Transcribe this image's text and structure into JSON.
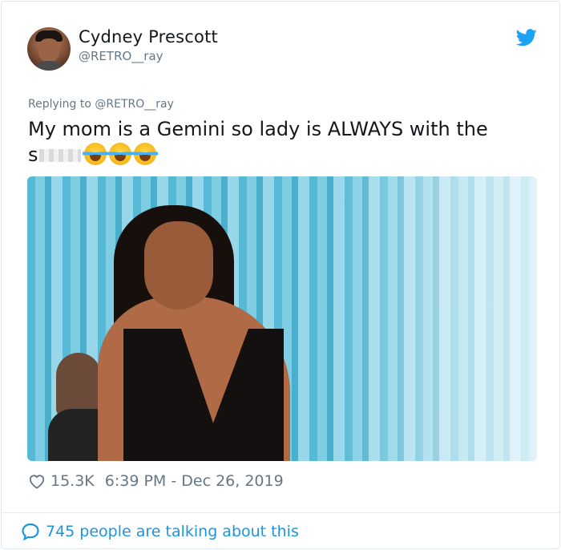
{
  "tweet": {
    "author_name": "Cydney Prescott",
    "author_handle": "@RETRO__ray",
    "replying_to": "Replying to @RETRO__ray",
    "text_line1": "My mom is a Gemini so lady is ALWAYS with the",
    "text_prefix": "s",
    "like_count": "15.3K",
    "timestamp": "6:39 PM - Dec 26, 2019",
    "conversation_label": "745 people are talking about this"
  },
  "icons": {
    "brand": "twitter-bird-icon",
    "like": "heart-icon",
    "conversation": "speech-bubble-icon",
    "emoji": "face-with-tears-of-joy-emoji"
  },
  "colors": {
    "twitter_blue": "#1b95e0",
    "secondary_text": "#657786",
    "primary_text": "#14171a"
  }
}
